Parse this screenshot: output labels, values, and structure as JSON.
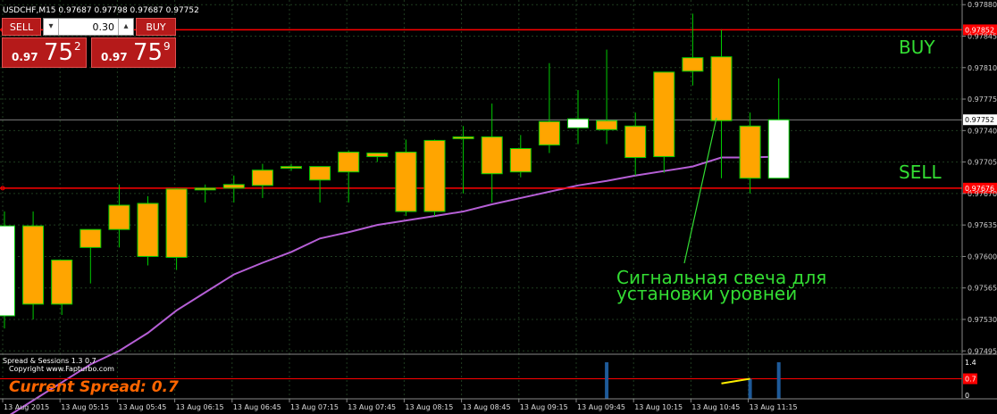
{
  "symbol_header": "USDCHF,M15  0.97687 0.97798 0.97687 0.97752",
  "trade_panel": {
    "sell_label": "SELL",
    "buy_label": "BUY",
    "lot_value": "0.30",
    "sell_price_small": "0.97",
    "sell_price_big": "75",
    "sell_price_sup": "2",
    "buy_price_small": "0.97",
    "buy_price_big": "75",
    "buy_price_sup": "9"
  },
  "colors": {
    "background": "#000000",
    "grid": "#1f3c1f",
    "bear_candle": "#ffa500",
    "bull_candle": "#ffffff",
    "wick": "#00cc00",
    "moving_average": "#b65fd6",
    "level_line": "#ff0000",
    "annotation": "#33dd33",
    "spread_text": "#ff6600",
    "spread_bar": "#1e5a99",
    "spread_line": "#ffee00"
  },
  "annotations": {
    "buy": "BUY",
    "sell": "SELL",
    "signal_line1": "Сигнальная свеча для",
    "signal_line2": "установки уровней"
  },
  "indicator": {
    "title": "Spread & Sessions 1.3 0.7",
    "copyright": "Copyright  www.Fapturbo.com",
    "current_spread": "Current Spread: 0.7",
    "axis_labels": [
      "1.4",
      "0.7",
      "0"
    ]
  },
  "chart_data": {
    "type": "candlestick",
    "ylim": [
      0.974923,
      0.978802
    ],
    "y_ticks": [
      "0.97880",
      "0.97845",
      "0.97810",
      "0.97775",
      "0.97740",
      "0.97705",
      "0.97670",
      "0.97635",
      "0.97600",
      "0.97565",
      "0.97530",
      "0.97495"
    ],
    "x_labels": [
      "13 Aug 2015",
      "13 Aug 05:15",
      "13 Aug 05:45",
      "13 Aug 06:15",
      "13 Aug 06:45",
      "13 Aug 07:15",
      "13 Aug 07:45",
      "13 Aug 08:15",
      "13 Aug 08:45",
      "13 Aug 09:15",
      "13 Aug 09:45",
      "13 Aug 10:15",
      "13 Aug 10:45",
      "13 Aug 11:15"
    ],
    "levels": [
      {
        "label": "0.97852",
        "value": 0.97852
      },
      {
        "label": "0.97676",
        "value": 0.97676
      }
    ],
    "current_price": {
      "label": "0.97752",
      "value": 0.97752
    },
    "candles": [
      {
        "o": 0.97634,
        "h": 0.9765,
        "l": 0.9752,
        "c": 0.97534
      },
      {
        "o": 0.97547,
        "h": 0.9765,
        "l": 0.9753,
        "c": 0.97634
      },
      {
        "o": 0.97547,
        "h": 0.97595,
        "l": 0.97535,
        "c": 0.97596
      },
      {
        "o": 0.9761,
        "h": 0.9763,
        "l": 0.9757,
        "c": 0.9763
      },
      {
        "o": 0.9763,
        "h": 0.9768,
        "l": 0.9761,
        "c": 0.97657
      },
      {
        "o": 0.976,
        "h": 0.97667,
        "l": 0.9759,
        "c": 0.97659
      },
      {
        "o": 0.97599,
        "h": 0.97676,
        "l": 0.97585,
        "c": 0.97675
      },
      {
        "o": 0.97676,
        "h": 0.9768,
        "l": 0.9766,
        "c": 0.97676
      },
      {
        "o": 0.97676,
        "h": 0.9769,
        "l": 0.9766,
        "c": 0.9768
      },
      {
        "o": 0.97679,
        "h": 0.97703,
        "l": 0.97665,
        "c": 0.97696
      },
      {
        "o": 0.977,
        "h": 0.97703,
        "l": 0.97695,
        "c": 0.977
      },
      {
        "o": 0.97685,
        "h": 0.977,
        "l": 0.9766,
        "c": 0.977
      },
      {
        "o": 0.97694,
        "h": 0.97718,
        "l": 0.9766,
        "c": 0.97716
      },
      {
        "o": 0.97711,
        "h": 0.97715,
        "l": 0.97705,
        "c": 0.97715
      },
      {
        "o": 0.9765,
        "h": 0.9773,
        "l": 0.97645,
        "c": 0.97716
      },
      {
        "o": 0.9765,
        "h": 0.9773,
        "l": 0.97645,
        "c": 0.97729
      },
      {
        "o": 0.97731,
        "h": 0.97745,
        "l": 0.9767,
        "c": 0.97733
      },
      {
        "o": 0.97692,
        "h": 0.9777,
        "l": 0.9766,
        "c": 0.97733
      },
      {
        "o": 0.97694,
        "h": 0.97735,
        "l": 0.97688,
        "c": 0.9772
      },
      {
        "o": 0.97724,
        "h": 0.97815,
        "l": 0.97715,
        "c": 0.9775
      },
      {
        "o": 0.97753,
        "h": 0.97785,
        "l": 0.97725,
        "c": 0.97743
      },
      {
        "o": 0.97741,
        "h": 0.9783,
        "l": 0.97725,
        "c": 0.97751
      },
      {
        "o": 0.9771,
        "h": 0.9776,
        "l": 0.9769,
        "c": 0.97745
      },
      {
        "o": 0.97711,
        "h": 0.978,
        "l": 0.97693,
        "c": 0.97805
      },
      {
        "o": 0.97806,
        "h": 0.9787,
        "l": 0.9779,
        "c": 0.97821
      },
      {
        "o": 0.97751,
        "h": 0.97852,
        "l": 0.97687,
        "c": 0.97822
      },
      {
        "o": 0.97687,
        "h": 0.9776,
        "l": 0.9767,
        "c": 0.97745
      },
      {
        "o": 0.97752,
        "h": 0.97798,
        "l": 0.97687,
        "c": 0.97687
      }
    ],
    "moving_average": [
      0.9742,
      0.9744,
      0.9746,
      0.9748,
      0.97495,
      0.97515,
      0.9754,
      0.9756,
      0.9758,
      0.97593,
      0.97605,
      0.9762,
      0.97627,
      0.97635,
      0.9764,
      0.97645,
      0.9765,
      0.97658,
      0.97665,
      0.97672,
      0.97679,
      0.97684,
      0.9769,
      0.97695,
      0.977,
      0.9771,
      0.9771,
      0.97711
    ],
    "spread_ylim": [
      0,
      1.4
    ],
    "spread_bars": [
      0,
      0,
      0,
      0,
      0,
      0,
      0,
      0,
      0,
      0,
      0,
      0,
      0,
      0,
      0,
      0,
      0,
      0,
      0,
      0,
      0,
      1.4,
      0,
      0,
      0,
      0,
      0.7,
      1.4
    ],
    "spread_line": [
      null,
      null,
      null,
      null,
      null,
      null,
      null,
      null,
      null,
      null,
      null,
      null,
      null,
      null,
      null,
      null,
      null,
      null,
      null,
      null,
      null,
      null,
      null,
      null,
      null,
      0.5,
      0.7,
      null
    ]
  }
}
